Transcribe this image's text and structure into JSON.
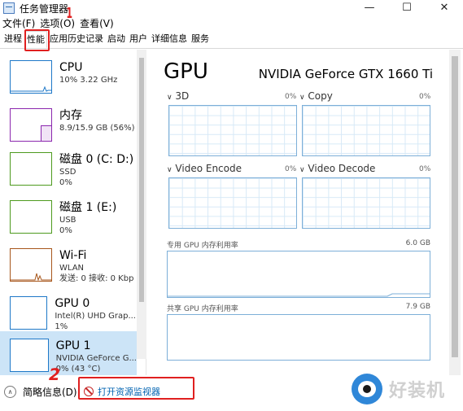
{
  "window": {
    "title": "任务管理器",
    "controls": [
      "—",
      "☐",
      "✕"
    ]
  },
  "menu": [
    "文件(F)",
    "选项(O)",
    "查看(V)"
  ],
  "tabs": [
    {
      "label": "进程",
      "active": false
    },
    {
      "label": "性能",
      "active": true
    },
    {
      "label": "应用历史记录",
      "active": false
    },
    {
      "label": "启动",
      "active": false
    },
    {
      "label": "用户",
      "active": false
    },
    {
      "label": "详细信息",
      "active": false
    },
    {
      "label": "服务",
      "active": false
    }
  ],
  "annotations": {
    "step1": "1",
    "step2": "2"
  },
  "sidebar": [
    {
      "name": "CPU",
      "line1": "10% 3.22 GHz",
      "line2": "",
      "color": "#1e78c8",
      "selected": false
    },
    {
      "name": "内存",
      "line1": "8.9/15.9 GB (56%)",
      "line2": "",
      "color": "#8b27ae",
      "selected": false
    },
    {
      "name": "磁盘 0 (C: D:)",
      "line1": "SSD",
      "line2": "0%",
      "color": "#4d9a1e",
      "selected": false
    },
    {
      "name": "磁盘 1 (E:)",
      "line1": "USB",
      "line2": "0%",
      "color": "#4d9a1e",
      "selected": false
    },
    {
      "name": "Wi-Fi",
      "line1": "WLAN",
      "line2": "发送: 0 接收: 0 Kbp",
      "color": "#a7561b",
      "selected": false
    },
    {
      "name": "GPU 0",
      "line1": "Intel(R) UHD Grap...",
      "line2": "1%",
      "color": "#1e78c8",
      "selected": false
    },
    {
      "name": "GPU 1",
      "line1": "NVIDIA GeForce G...",
      "line2": "0% (43 °C)",
      "color": "#1e78c8",
      "selected": true
    }
  ],
  "main": {
    "title": "GPU",
    "model": "NVIDIA GeForce GTX 1660 Ti",
    "engines": [
      {
        "label": "3D",
        "pct": "0%"
      },
      {
        "label": "Copy",
        "pct": "0%"
      },
      {
        "label": "Video Encode",
        "pct": "0%"
      },
      {
        "label": "Video Decode",
        "pct": "0%"
      }
    ],
    "dedicated_label": "专用 GPU 内存利用率",
    "dedicated_max": "6.0 GB",
    "shared_label": "共享 GPU 内存利用率",
    "shared_max": "7.9 GB"
  },
  "footer": {
    "fewer_details": "简略信息(D)",
    "open_monitor": "打开资源监视器"
  },
  "watermark": "好装机"
}
